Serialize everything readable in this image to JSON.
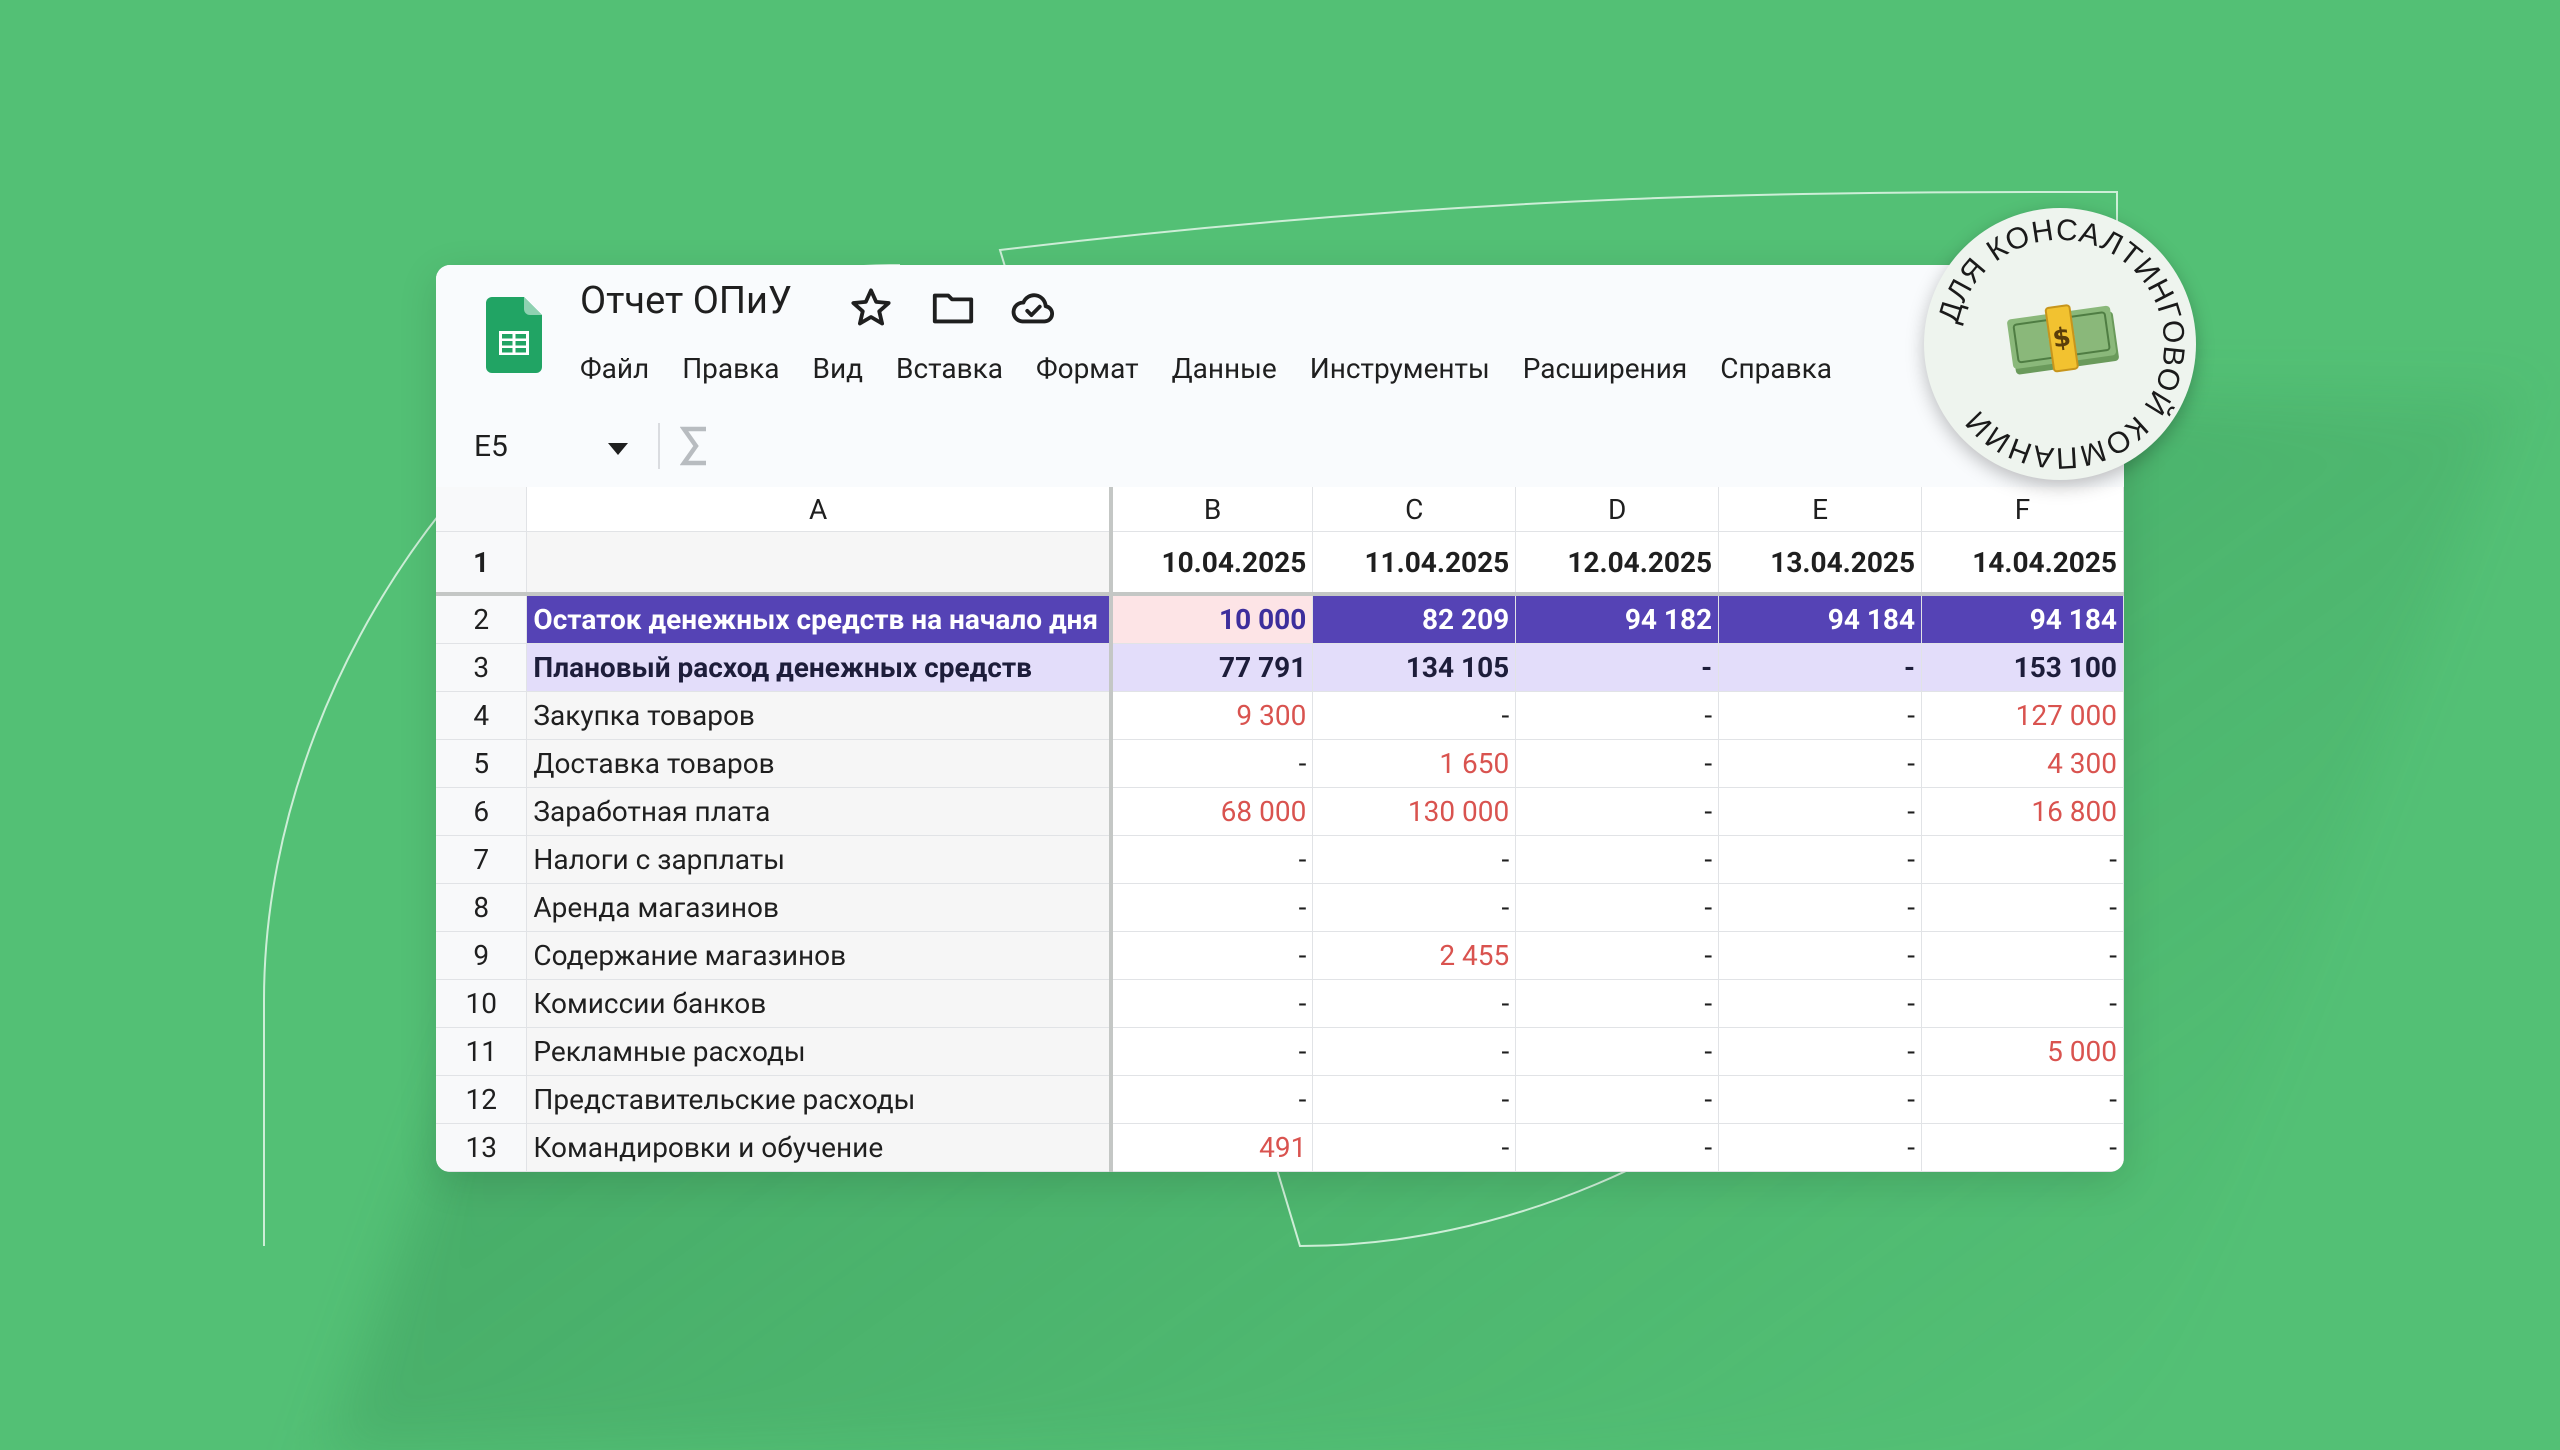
{
  "doc": {
    "title": "Отчет ОПиУ"
  },
  "menu": [
    "Файл",
    "Правка",
    "Вид",
    "Вставка",
    "Формат",
    "Данные",
    "Инструменты",
    "Расширения",
    "Справка"
  ],
  "formula_bar": {
    "cell_ref": "E5"
  },
  "columns": [
    "A",
    "B",
    "C",
    "D",
    "E",
    "F"
  ],
  "rows": [
    {
      "num": "1",
      "label": "",
      "values": [
        "10.04.2025",
        "11.04.2025",
        "12.04.2025",
        "13.04.2025",
        "14.04.2025"
      ]
    },
    {
      "num": "2",
      "label": "Остаток денежных средств на начало дня",
      "values": [
        "10 000",
        "82 209",
        "94 182",
        "94 184",
        "94 184"
      ]
    },
    {
      "num": "3",
      "label": "Плановый расход денежных средств",
      "values": [
        "77 791",
        "134 105",
        "-",
        "-",
        "153 100"
      ]
    },
    {
      "num": "4",
      "label": "Закупка товаров",
      "values": [
        "9 300",
        "-",
        "-",
        "-",
        "127 000"
      ]
    },
    {
      "num": "5",
      "label": "Доставка товаров",
      "values": [
        "-",
        "1 650",
        "-",
        "-",
        "4 300"
      ]
    },
    {
      "num": "6",
      "label": "Заработная плата",
      "values": [
        "68 000",
        "130 000",
        "-",
        "-",
        "16 800"
      ]
    },
    {
      "num": "7",
      "label": "Налоги с зарплаты",
      "values": [
        "-",
        "-",
        "-",
        "-",
        "-"
      ]
    },
    {
      "num": "8",
      "label": "Аренда магазинов",
      "values": [
        "-",
        "-",
        "-",
        "-",
        "-"
      ]
    },
    {
      "num": "9",
      "label": "Содержание магазинов",
      "values": [
        "-",
        "2 455",
        "-",
        "-",
        "-"
      ]
    },
    {
      "num": "10",
      "label": "Комиссии банков",
      "values": [
        "-",
        "-",
        "-",
        "-",
        "-"
      ]
    },
    {
      "num": "11",
      "label": "Рекламные расходы",
      "values": [
        "-",
        "-",
        "-",
        "-",
        "5 000"
      ]
    },
    {
      "num": "12",
      "label": "Представительские расходы",
      "values": [
        "-",
        "-",
        "-",
        "-",
        "-"
      ]
    },
    {
      "num": "13",
      "label": "Командировки и обучение",
      "values": [
        "491",
        "-",
        "-",
        "-",
        "-"
      ]
    }
  ],
  "badge": {
    "text": "ДЛЯ КОНСАЛТИНГОВОЙ КОМПАНИИ",
    "icon": "money-bag-emoji-icon"
  },
  "colors": {
    "background": "#53c075",
    "row2_fill": "#5543b5",
    "row3_fill": "#e3ddfa",
    "negative_text": "#d9534f",
    "b2_highlight": "#fde4e6"
  }
}
